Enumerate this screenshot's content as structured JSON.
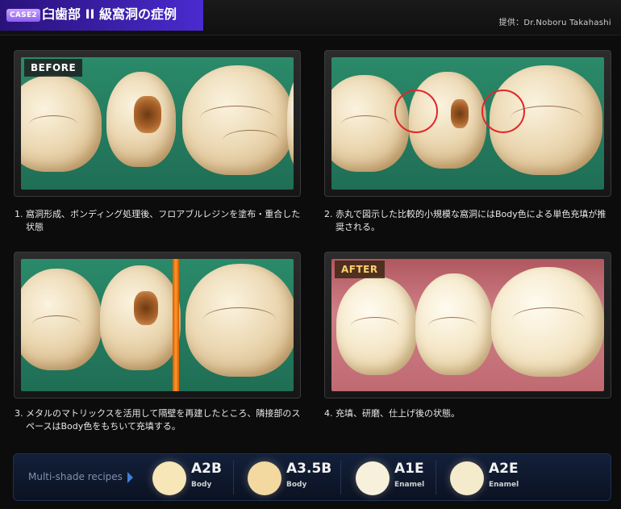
{
  "header": {
    "case_badge": "CASE2",
    "title": "臼歯部 II 級窩洞の症例",
    "credit": "提供：Dr.Noboru Takahashi"
  },
  "photos": [
    {
      "tag": "BEFORE",
      "caption": "1. 窩洞形成、ボンディング処理後、フロアブルレジンを塗布・重合した状態"
    },
    {
      "tag": "",
      "caption": "2. 赤丸で図示した比較的小規模な窩洞にはBody色による単色充填が推奨される。"
    },
    {
      "tag": "",
      "caption": "3. メタルのマトリックスを活用して隔壁を再建したところ、隣接部のスペースはBody色をもちいて充填する。"
    },
    {
      "tag": "AFTER",
      "caption": "4. 充填、研磨、仕上げ後の状態。"
    }
  ],
  "recipes": {
    "label": "Multi-shade recipes",
    "items": [
      {
        "shade": "A2B",
        "type": "Body",
        "color": "#f6e6b8"
      },
      {
        "shade": "A3.5B",
        "type": "Body",
        "color": "#f3d8a0"
      },
      {
        "shade": "A1E",
        "type": "Enamel",
        "color": "#f7f1dc"
      },
      {
        "shade": "A2E",
        "type": "Enamel",
        "color": "#f4ebcc"
      }
    ]
  },
  "colors": {
    "header_accent": "#3a1fa8",
    "marker_red": "#e2262a",
    "after_tag": "#ffcf6e"
  }
}
